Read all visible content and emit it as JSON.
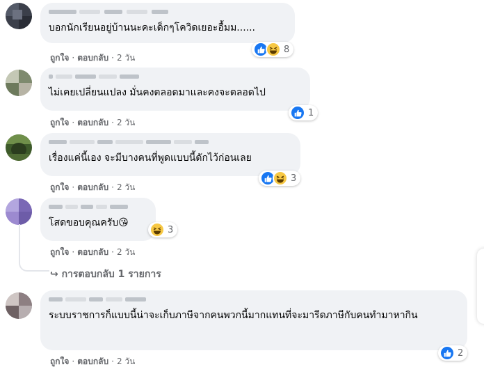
{
  "comments": [
    {
      "text": "บอกนักเรียนอยู่บ้านนะคะเด็กๆโควิดเยอะอื้มม......",
      "reaction_count": "8",
      "reactions": [
        "like-icon",
        "haha-icon"
      ],
      "actions": {
        "like": "ถูกใจ",
        "reply": "ตอบกลับ",
        "time": "2 วัน"
      }
    },
    {
      "text": "ไม่เคยเปลี่ยนแปลง มั่นคงตลอดมาและคงจะตลอดไป",
      "reaction_count": "1",
      "reactions": [
        "like-icon"
      ],
      "actions": {
        "like": "ถูกใจ",
        "reply": "ตอบกลับ",
        "time": "2 วัน"
      }
    },
    {
      "text": "เรื่องแค่นี้เอง จะมีบางคนที่พูดแบบนี้ดักไว้ก่อนเลย",
      "reaction_count": "3",
      "reactions": [
        "like-icon",
        "haha-icon"
      ],
      "actions": {
        "like": "ถูกใจ",
        "reply": "ตอบกลับ",
        "time": "2 วัน"
      }
    },
    {
      "text": "โสดขอบคุณครับ",
      "emoji": "😘",
      "reaction_count": "3",
      "reactions": [
        "haha-icon"
      ],
      "actions": {
        "like": "ถูกใจ",
        "reply": "ตอบกลับ",
        "time": "2 วัน"
      }
    },
    {
      "text": "ระบบราชการก็แบบนี้น่าจะเก็บภาษีจากคนพวกนี้มากแทนที่จะมารีดภาษีกับคนทำมาหากิน",
      "reaction_count": "2",
      "reactions": [
        "like-icon"
      ],
      "actions": {
        "like": "ถูกใจ",
        "reply": "ตอบกลับ",
        "time": "2 วัน"
      }
    }
  ],
  "replies_link": "การตอบกลับ 1 รายการ",
  "colors": {
    "bubble": "#f0f2f5",
    "like": "#1877f2",
    "haha": "#f7c844",
    "secondary_text": "#65676b"
  }
}
